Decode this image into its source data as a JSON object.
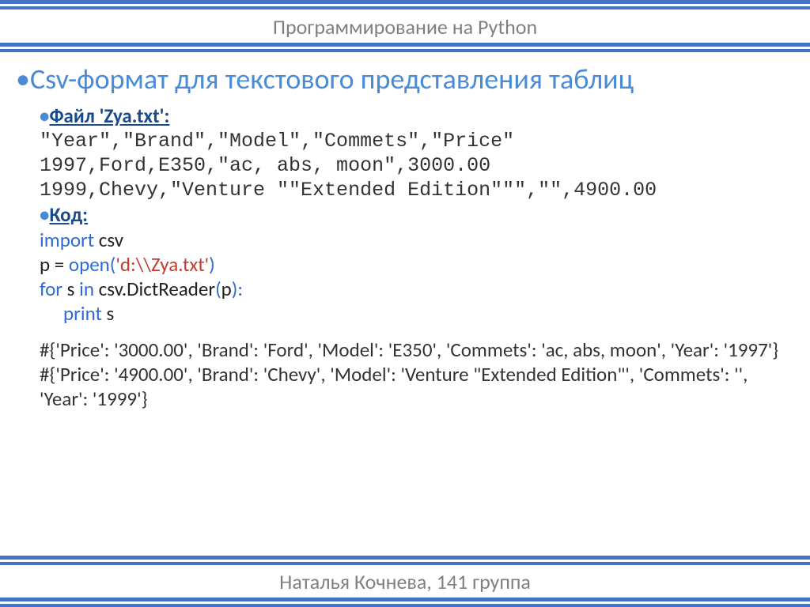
{
  "header": "Программирование на Python",
  "footer": "Наталья Кочнева, 141 группа",
  "title": "Csv-формат для текстового представления таблиц",
  "file_label": "Файл 'Zya.txt':",
  "file_lines": {
    "l1": "\"Year\",\"Brand\",\"Model\",\"Commets\",\"Price\"",
    "l2": "1997,Ford,E350,\"ac, abs, moon\",3000.00",
    "l3": "1999,Chevy,\"Venture \"\"Extended Edition\"\"\",\"\",4900.00"
  },
  "code_label": "Код:",
  "code": {
    "import_kw": "import",
    "import_mod": "csv",
    "assign": "p = ",
    "open_fn": "open(",
    "open_arg": "'d:\\\\Zya.txt'",
    "close_paren": ")",
    "for_kw": "for",
    "for_mid": " s ",
    "in_kw": "in",
    "dictreader": " csv.DictReader",
    "dr_open": "(",
    "dr_arg": "p",
    "dr_close": "):",
    "print_kw": "print",
    "print_arg": " s"
  },
  "output": {
    "o1": "#{'Price': '3000.00', 'Brand': 'Ford', 'Model': 'E350', 'Commets': 'ac, abs, moon', 'Year': '1997'}",
    "o2": "#{'Price': '4900.00', 'Brand': 'Chevy', 'Model': 'Venture \"Extended Edition\"', 'Commets': '', 'Year': '1999'}"
  }
}
